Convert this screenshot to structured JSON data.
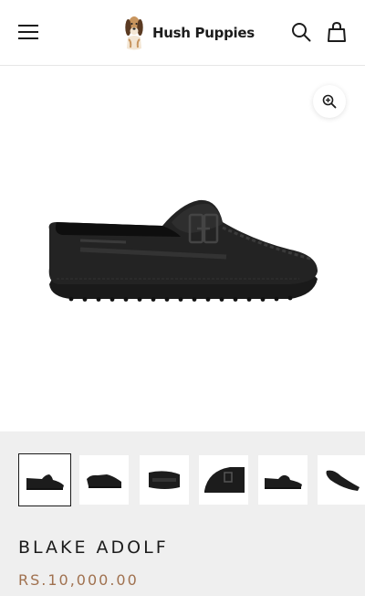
{
  "header": {
    "brand_name": "Hush Puppies",
    "menu_icon": "hamburger-menu-icon",
    "search_icon": "search-icon",
    "cart_icon": "shopping-bag-icon"
  },
  "gallery": {
    "zoom_icon": "zoom-in-icon",
    "thumbnail_count": 6,
    "active_thumbnail": 1
  },
  "product": {
    "name": "BLAKE ADOLF",
    "price": "RS.10,000.00"
  },
  "colors": {
    "price": "#a0714f",
    "info_background": "#efefef",
    "text": "#1c1c1c"
  }
}
